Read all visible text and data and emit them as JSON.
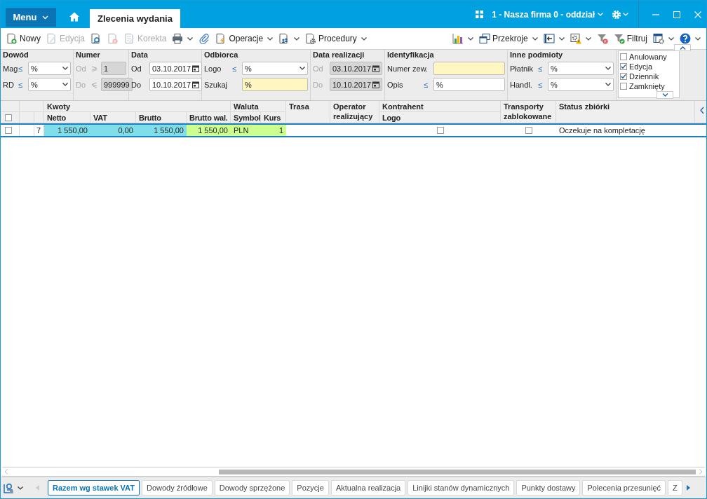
{
  "window": {
    "menu": "Menu",
    "tab": "Zlecenia wydania",
    "company": "1 - Nasza firma 0 - oddział"
  },
  "toolbar_left": [
    {
      "label": "Nowy",
      "disabled": false,
      "dropdown": false
    },
    {
      "label": "Edycja",
      "disabled": true,
      "dropdown": false
    },
    {
      "disabled": false,
      "dropdown": false
    },
    {
      "disabled": true,
      "dropdown": false
    },
    {
      "label": "Korekta",
      "disabled": true,
      "dropdown": false
    },
    {
      "disabled": false,
      "dropdown": true
    },
    {
      "disabled": false,
      "dropdown": false
    },
    {
      "label": "Operacje",
      "disabled": false,
      "dropdown": true
    },
    {
      "disabled": false,
      "dropdown": true
    },
    {
      "label": "Procedury",
      "disabled": false,
      "dropdown": true
    }
  ],
  "toolbar_right": [
    {
      "disabled": false,
      "dropdown": true
    },
    {
      "label": "Przekroje",
      "disabled": false,
      "dropdown": true
    },
    {
      "disabled": false,
      "dropdown": true
    },
    {
      "disabled": false,
      "dropdown": true
    },
    {
      "disabled": false,
      "dropdown": false
    },
    {
      "label": "Filtruj",
      "disabled": false,
      "dropdown": false
    },
    {
      "disabled": false,
      "dropdown": true
    },
    {
      "disabled": false,
      "dropdown": true
    }
  ],
  "filters": [
    {
      "title": "Dowód",
      "rows": [
        {
          "label": "Mag",
          "op": "≤",
          "kind": "select",
          "value": "%",
          "disabled": false,
          "highlighted": false
        },
        {
          "label": "RD",
          "op": "≤",
          "kind": "select",
          "value": "%",
          "disabled": false,
          "highlighted": false
        }
      ]
    },
    {
      "title": "Numer",
      "rows": [
        {
          "label": "Od",
          "op": "⩾",
          "kind": "text",
          "value": "1",
          "disabled": true,
          "highlighted": false
        },
        {
          "label": "Do",
          "op": "⩽",
          "kind": "text",
          "value": "999999",
          "disabled": true,
          "highlighted": false
        }
      ]
    },
    {
      "title": "Data",
      "rows": [
        {
          "label": "Od",
          "kind": "date",
          "value": "03.10.2017",
          "disabled": false,
          "highlighted": false
        },
        {
          "label": "Do",
          "kind": "date",
          "value": "10.10.2017",
          "disabled": false,
          "highlighted": false
        }
      ]
    },
    {
      "title": "Odbiorca",
      "rows": [
        {
          "label": "Logo",
          "op": "≤",
          "kind": "select",
          "value": "%",
          "disabled": false,
          "highlighted": false
        },
        {
          "label": "Szukaj",
          "kind": "text",
          "value": "%",
          "disabled": false,
          "highlighted": true
        }
      ]
    },
    {
      "title": "Data realizacji",
      "rows": [
        {
          "label": "Od",
          "kind": "date",
          "value": "03.10.2017",
          "disabled": true,
          "highlighted": false
        },
        {
          "label": "Do",
          "kind": "date",
          "value": "10.10.2017",
          "disabled": true,
          "highlighted": false
        }
      ]
    },
    {
      "title": "Identyfikacja",
      "rows": [
        {
          "label": "Numer zew.",
          "kind": "text",
          "disabled": false,
          "highlighted": true
        },
        {
          "label": "Opis",
          "op": "≤",
          "kind": "text",
          "value": "%",
          "disabled": false,
          "highlighted": false
        }
      ]
    },
    {
      "title": "Inne podmioty",
      "rows": [
        {
          "label": "Płatnik",
          "op": "≤",
          "kind": "select",
          "value": "%",
          "disabled": false,
          "highlighted": false
        },
        {
          "label": "Handl.",
          "op": "≤",
          "kind": "select",
          "value": "%",
          "disabled": false,
          "highlighted": false
        }
      ]
    }
  ],
  "status_filter": [
    {
      "label": "Anulowany",
      "checked": false
    },
    {
      "label": "Edycja",
      "checked": true
    },
    {
      "label": "Dziennik",
      "checked": true
    },
    {
      "label": "Zamknięty",
      "checked": false
    }
  ],
  "table": {
    "select_all": {
      "checked": false
    },
    "column_groups": [
      {
        "label": "Kwoty",
        "columns": [
          {
            "label": "Netto"
          },
          {
            "label": "VAT"
          },
          {
            "label": "Brutto"
          },
          {
            "label": "Brutto wal."
          }
        ]
      },
      {
        "label": "Waluta",
        "columns": [
          {
            "label": "Symbol"
          },
          {
            "label": "Kurs"
          }
        ]
      },
      {
        "columns": [
          {
            "label": "Trasa"
          }
        ]
      },
      {
        "columns": [
          {
            "label": "Operator realizujący"
          }
        ]
      },
      {
        "label": "Kontrahent",
        "columns": [
          {
            "label": "Logo"
          }
        ]
      },
      {
        "columns": [
          {
            "label": "Transporty zablokowane"
          }
        ]
      },
      {
        "columns": [
          {
            "label": "Status zbiórki"
          }
        ]
      }
    ],
    "rows": [
      {
        "selected": true,
        "checked": false,
        "number": "7",
        "cells": [
          {
            "kind": "number",
            "text": "1 550,00",
            "color": "#80deea"
          },
          {
            "kind": "number",
            "text": "0,00",
            "color": "#80deea"
          },
          {
            "kind": "number",
            "text": "1 550,00",
            "color": "#80deea"
          },
          {
            "kind": "number",
            "text": "1 550,00",
            "color": "#ccff90"
          },
          {
            "kind": "text",
            "text": "PLN",
            "color": "#ccff90"
          },
          {
            "kind": "number",
            "text": "1",
            "color": "#ccff90"
          },
          {
            "kind": "empty"
          },
          {
            "kind": "empty"
          },
          {
            "kind": "check",
            "checked": false
          },
          {
            "kind": "check",
            "checked": false
          },
          {
            "kind": "text",
            "text": "Oczekuje na kompletację"
          }
        ]
      }
    ]
  },
  "bottom_tabs": [
    {
      "label": "Razem wg stawek VAT",
      "selected": true
    },
    {
      "label": "Dowody źródłowe",
      "selected": false
    },
    {
      "label": "Dowody sprzężone",
      "selected": false
    },
    {
      "label": "Pozycje",
      "selected": false
    },
    {
      "label": "Aktualna realizacja",
      "selected": false
    },
    {
      "label": "Linijki stanów dynamicznych",
      "selected": false
    },
    {
      "label": "Punkty dostawy",
      "selected": false
    },
    {
      "label": "Polecenia przesunięć",
      "selected": false
    },
    {
      "label": "Z",
      "selected": false
    }
  ]
}
